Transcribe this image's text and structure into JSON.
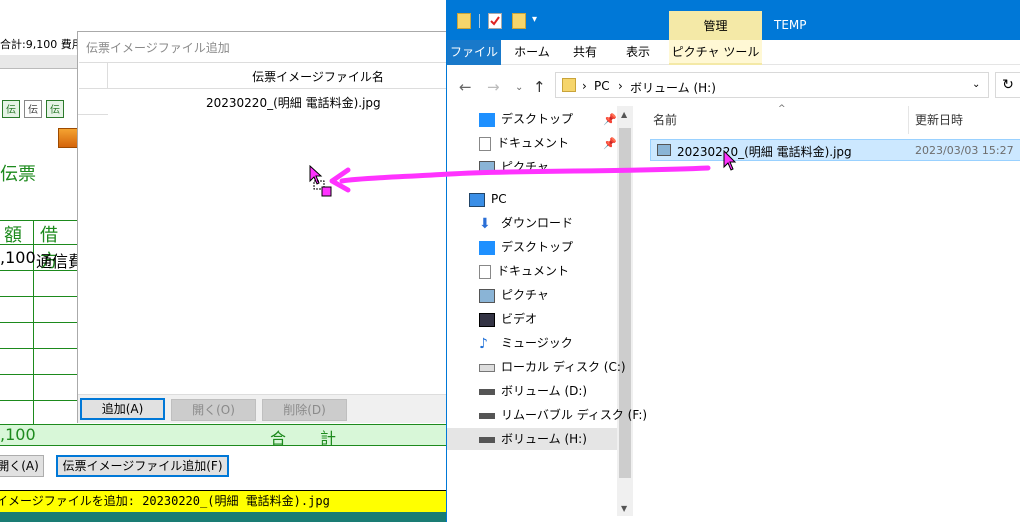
{
  "bgapp": {
    "top_info": "合計:9,100  費用",
    "slip_label": "伝票",
    "header_cols": [
      "額",
      "借 方"
    ],
    "row1_amount": ",100",
    "row1_account": "通信費",
    "total_amount": ",100",
    "total_label": "合計",
    "open_button": "開く(A)",
    "add_image_button": "伝票イメージファイル追加(F)",
    "status_text": "イメージファイルを追加: 20230220_(明細 電話料金).jpg"
  },
  "dialog": {
    "title": "伝票イメージファイル追加",
    "column_header": "伝票イメージファイル名",
    "rows": [
      "20230220_(明細 電話料金).jpg"
    ],
    "add_button": "追加(A)",
    "open_button": "開く(O)",
    "delete_button": "削除(D)"
  },
  "explorer": {
    "window_title": "TEMP",
    "manage_tab": "管理",
    "tabs": [
      "ファイル",
      "ホーム",
      "共有",
      "表示",
      "ピクチャ ツール"
    ],
    "breadcrumb": [
      "PC",
      "ボリューム (H:)"
    ],
    "nav_quick": [
      {
        "label": "デスクトップ",
        "icon": "desktop-icon",
        "pinned": true
      },
      {
        "label": "ドキュメント",
        "icon": "documents-icon",
        "pinned": true
      },
      {
        "label": "ピクチャ",
        "icon": "pictures-icon",
        "pinned": true
      }
    ],
    "nav_pc_label": "PC",
    "nav_pc_items": [
      {
        "label": "ダウンロード",
        "icon": "download-icon"
      },
      {
        "label": "デスクトップ",
        "icon": "desktop-icon"
      },
      {
        "label": "ドキュメント",
        "icon": "documents-icon"
      },
      {
        "label": "ピクチャ",
        "icon": "pictures-icon"
      },
      {
        "label": "ビデオ",
        "icon": "video-icon"
      },
      {
        "label": "ミュージック",
        "icon": "music-icon"
      },
      {
        "label": "ローカル ディスク (C:)",
        "icon": "local-disk-icon"
      },
      {
        "label": "ボリューム (D:)",
        "icon": "drive-icon"
      },
      {
        "label": "リムーバブル ディスク (F:)",
        "icon": "removable-drive-icon"
      },
      {
        "label": "ボリューム (H:)",
        "icon": "drive-icon",
        "selected": true
      }
    ],
    "col_name": "名前",
    "col_date": "更新日時",
    "files": [
      {
        "name": "20230220_(明細 電話料金).jpg",
        "date": "2023/03/03 15:27",
        "selected": true
      }
    ]
  },
  "colors": {
    "accent_blue": "#0078d7",
    "green": "#1d8a1d",
    "status_yellow": "#ffff00",
    "drag_arrow": "#ff33ff"
  }
}
